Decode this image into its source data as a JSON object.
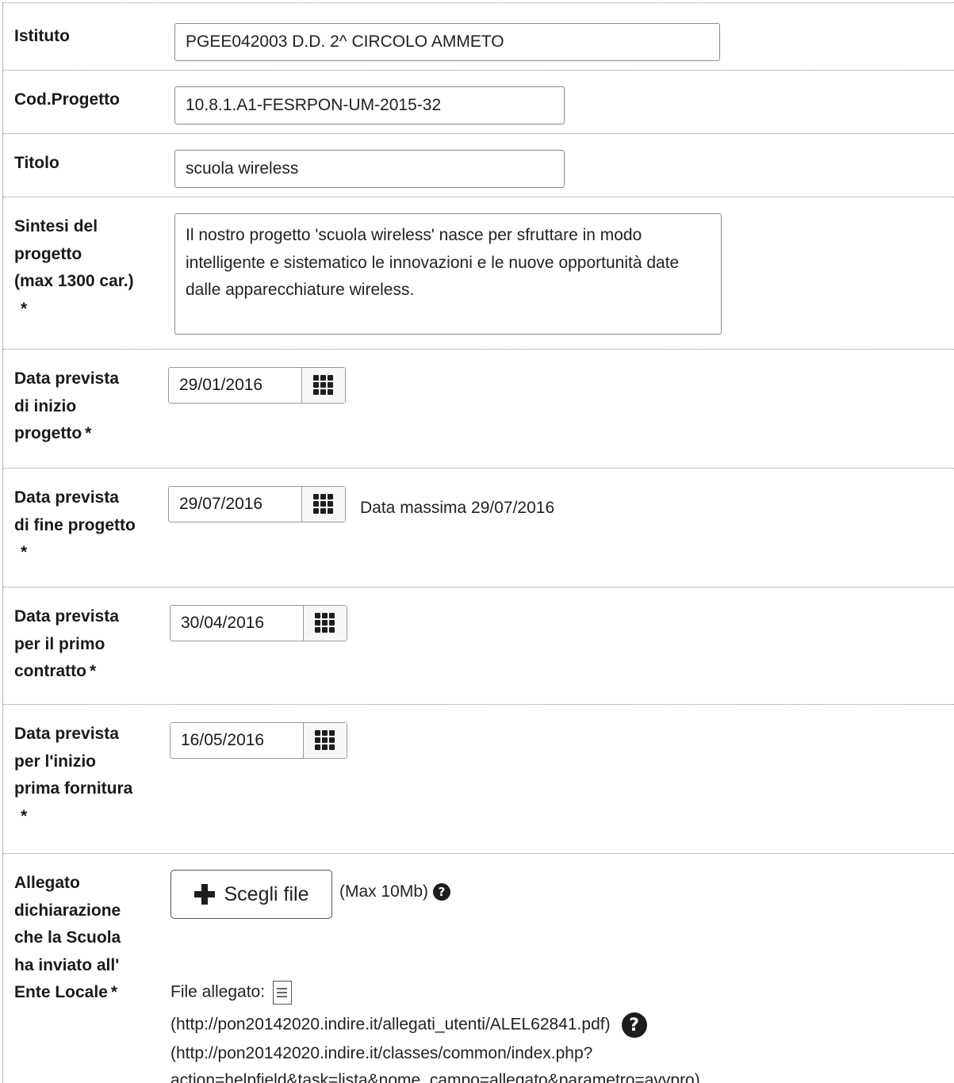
{
  "fields": {
    "istituto": {
      "label": "Istituto",
      "value": "PGEE042003 D.D. 2^ CIRCOLO AMMETO"
    },
    "cod_progetto": {
      "label": "Cod.Progetto",
      "value": "10.8.1.A1-FESRPON-UM-2015-32"
    },
    "titolo": {
      "label": "Titolo",
      "value": "scuola wireless"
    },
    "sintesi": {
      "label_lines": [
        "Sintesi del",
        "progetto",
        "(max 1300 car.)"
      ],
      "required_mark": "*",
      "value": "Il nostro progetto 'scuola wireless' nasce per sfruttare in modo intelligente e sistematico le innovazioni e le nuove opportunità date dalle apparecchiature wireless."
    },
    "data_inizio": {
      "label_lines": [
        "Data prevista",
        "di inizio",
        "progetto"
      ],
      "required_mark": "*",
      "value": "29/01/2016",
      "calendar_icon": "calendar-grid-icon"
    },
    "data_fine": {
      "label_lines": [
        "Data prevista",
        "di fine progetto"
      ],
      "required_mark": "*",
      "value": "29/07/2016",
      "note": "Data massima 29/07/2016",
      "calendar_icon": "calendar-grid-icon"
    },
    "data_contratto": {
      "label_lines": [
        "Data prevista",
        "per il primo",
        "contratto"
      ],
      "required_mark": "*",
      "value": "30/04/2016",
      "calendar_icon": "calendar-grid-icon"
    },
    "data_fornitura": {
      "label_lines": [
        "Data prevista",
        "per l'inizio",
        "prima fornitura"
      ],
      "required_mark": "*",
      "value": "16/05/2016",
      "calendar_icon": "calendar-grid-icon"
    },
    "allegato": {
      "label_lines": [
        "Allegato",
        "dichiarazione",
        "che la Scuola",
        "ha inviato all'",
        "Ente Locale"
      ],
      "required_mark": "*",
      "button_label": "Scegli file",
      "max_size": "(Max 10Mb)",
      "file_label": "File allegato:",
      "file_url": "(http://pon20142020.indire.it/allegati_utenti/ALEL62841.pdf)",
      "help_url_1": "(http://pon20142020.indire.it/classes/common/index.php?",
      "help_url_2": "action=helpfield&task=lista&nome_campo=allegato&parametro=avvpro)",
      "help_glyph": "?"
    }
  }
}
